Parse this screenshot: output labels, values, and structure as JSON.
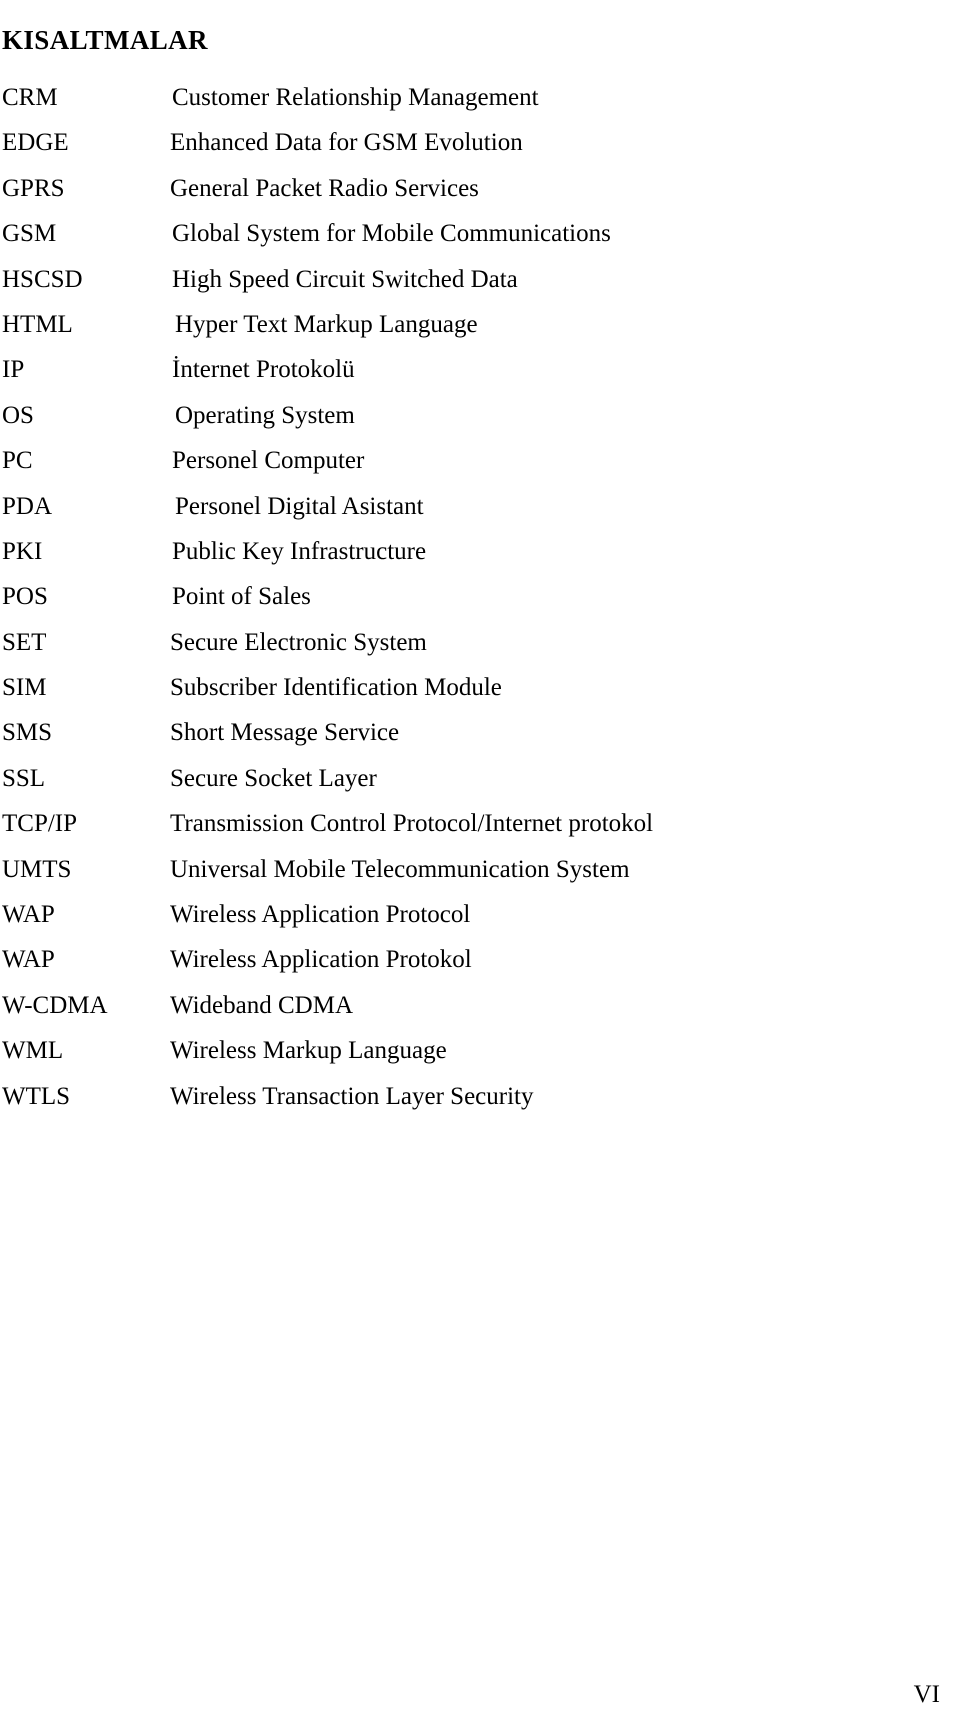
{
  "document": {
    "heading": "KISALTMALAR",
    "page_number": "VI"
  },
  "abbreviations": [
    {
      "term": "CRM",
      "definition": "Customer Relationship Management",
      "indent": 1
    },
    {
      "term": "EDGE",
      "definition": "Enhanced Data for GSM Evolution",
      "indent": 0
    },
    {
      "term": "GPRS",
      "definition": "General Packet Radio Services",
      "indent": 0
    },
    {
      "term": "GSM",
      "definition": "Global System for Mobile Communications",
      "indent": 1
    },
    {
      "term": "HSCSD",
      "definition": "High Speed Circuit Switched Data",
      "indent": 1
    },
    {
      "term": "HTML",
      "definition": "Hyper Text Markup Language",
      "indent": 2
    },
    {
      "term": "IP",
      "definition": "İnternet Protokolü",
      "indent": 1
    },
    {
      "term": "OS",
      "definition": "Operating System",
      "indent": 2
    },
    {
      "term": "PC",
      "definition": "Personel Computer",
      "indent": 1
    },
    {
      "term": "PDA",
      "definition": "Personel Digital Asistant",
      "indent": 2
    },
    {
      "term": "PKI",
      "definition": "Public Key Infrastructure",
      "indent": 1
    },
    {
      "term": "POS",
      "definition": "Point of Sales",
      "indent": 1
    },
    {
      "term": "SET",
      "definition": "Secure Electronic System",
      "indent": 0
    },
    {
      "term": "SIM",
      "definition": "Subscriber Identification Module",
      "indent": 0
    },
    {
      "term": "SMS",
      "definition": "Short Message Service",
      "indent": 0
    },
    {
      "term": "SSL",
      "definition": "Secure Socket Layer",
      "indent": 0
    },
    {
      "term": "TCP/IP",
      "definition": "Transmission Control Protocol/Internet protokol",
      "indent": 0
    },
    {
      "term": "UMTS",
      "definition": "Universal Mobile Telecommunication System",
      "indent": 0
    },
    {
      "term": "WAP",
      "definition": "Wireless Application Protocol",
      "indent": 0
    },
    {
      "term": "WAP",
      "definition": "Wireless Application Protokol",
      "indent": 0
    },
    {
      "term": "W-CDMA",
      "definition": "Wideband CDMA",
      "indent": 0
    },
    {
      "term": "WML",
      "definition": "Wireless Markup Language",
      "indent": 0
    },
    {
      "term": "WTLS",
      "definition": "Wireless Transaction Layer Security",
      "indent": 0
    }
  ]
}
